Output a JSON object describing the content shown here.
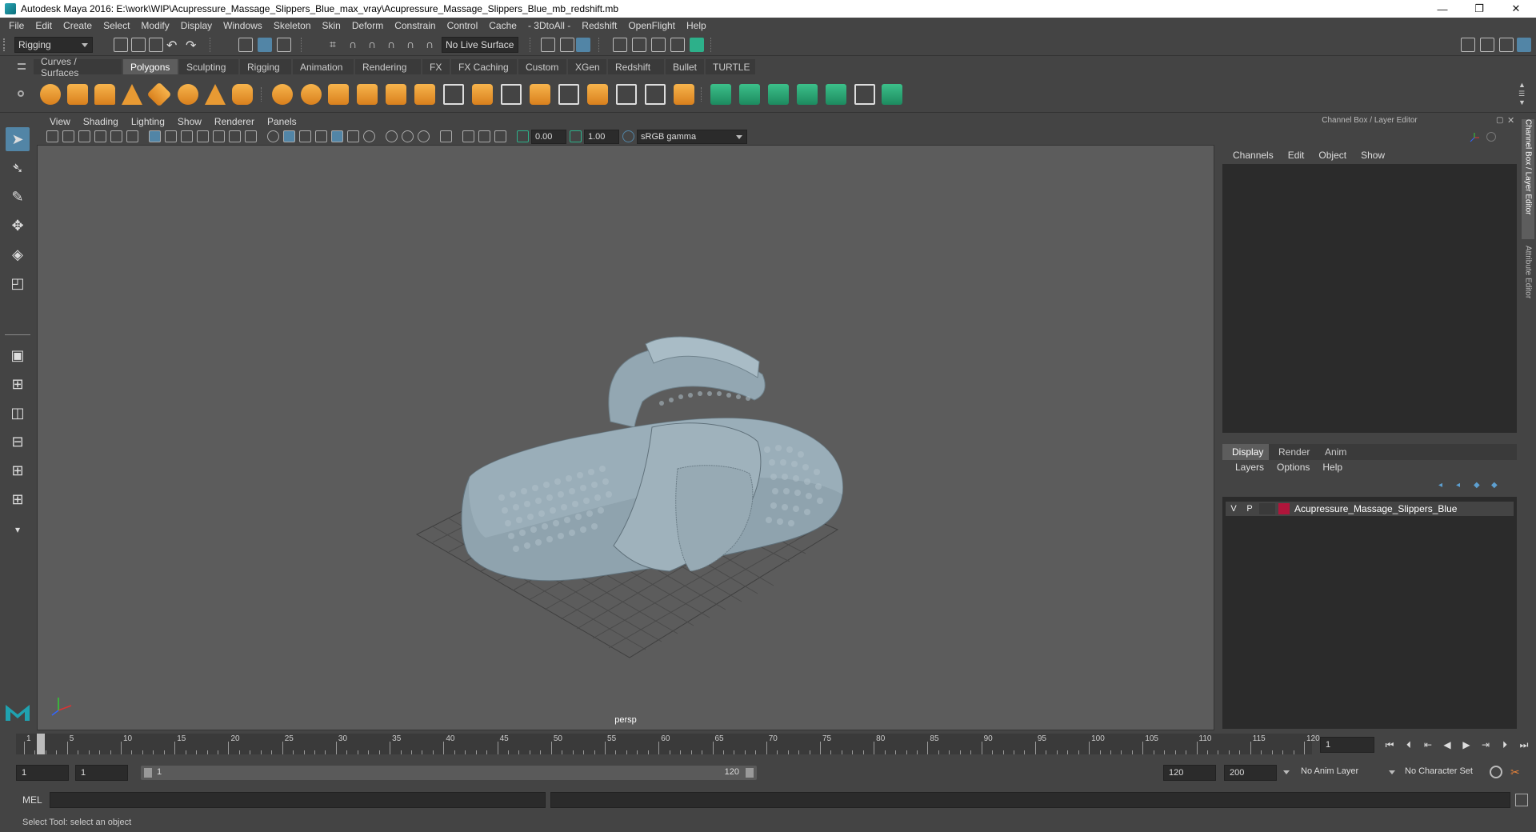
{
  "window": {
    "title": "Autodesk Maya 2016: E:\\work\\WIP\\Acupressure_Massage_Slippers_Blue_max_vray\\Acupressure_Massage_Slippers_Blue_mb_redshift.mb",
    "minimize": "—",
    "maximize": "❐",
    "close": "✕"
  },
  "menubar": [
    "File",
    "Edit",
    "Create",
    "Select",
    "Modify",
    "Display",
    "Windows",
    "Skeleton",
    "Skin",
    "Deform",
    "Constrain",
    "Control",
    "Cache",
    "- 3DtoAll -",
    "Redshift",
    "OpenFlight",
    "Help"
  ],
  "statusline": {
    "mode": "Rigging",
    "live_surface": "No Live Surface"
  },
  "shelf_tabs": [
    {
      "label": "Curves / Surfaces",
      "active": false
    },
    {
      "label": "Polygons",
      "active": true
    },
    {
      "label": "Sculpting",
      "active": false
    },
    {
      "label": "Rigging",
      "active": false
    },
    {
      "label": "Animation",
      "active": false
    },
    {
      "label": "Rendering",
      "active": false
    },
    {
      "label": "FX",
      "active": false
    },
    {
      "label": "FX Caching",
      "active": false
    },
    {
      "label": "Custom",
      "active": false
    },
    {
      "label": "XGen",
      "active": false
    },
    {
      "label": "Redshift",
      "active": false
    },
    {
      "label": "Bullet",
      "active": false
    },
    {
      "label": "TURTLE",
      "active": false
    }
  ],
  "viewport": {
    "menu": [
      "View",
      "Shading",
      "Lighting",
      "Show",
      "Renderer",
      "Panels"
    ],
    "exposure": "0.00",
    "gamma": "1.00",
    "color_space": "sRGB gamma",
    "camera": "persp"
  },
  "right_panel": {
    "header": "Channel Box / Layer Editor",
    "tabs": [
      "Channels",
      "Edit",
      "Object",
      "Show"
    ],
    "layer_tabs": [
      {
        "label": "Display",
        "active": true
      },
      {
        "label": "Render",
        "active": false
      },
      {
        "label": "Anim",
        "active": false
      }
    ],
    "layer_menu": [
      "Layers",
      "Options",
      "Help"
    ],
    "layer": {
      "v": "V",
      "p": "P",
      "name": "Acupressure_Massage_Slippers_Blue",
      "color": "#b0153b"
    },
    "side_tabs": [
      "Channel Box / Layer Editor",
      "Attribute Editor"
    ]
  },
  "timeslider": {
    "labels": [
      "1",
      "5",
      "10",
      "15",
      "20",
      "25",
      "30",
      "35",
      "40",
      "45",
      "50",
      "55",
      "60",
      "65",
      "70",
      "75",
      "80",
      "85",
      "90",
      "95",
      "100",
      "105",
      "110",
      "115",
      "120"
    ],
    "current_frame": "1"
  },
  "range": {
    "start": "1",
    "playback_start": "1",
    "slider_start": "1",
    "slider_end": "120",
    "playback_end": "120",
    "end": "200",
    "anim_layer": "No Anim Layer",
    "character_set": "No Character Set"
  },
  "command": {
    "label": "MEL"
  },
  "help_line": "Select Tool: select an object",
  "colors": {
    "accent": "#5285a6",
    "viewport_bg": "#5c5c5c",
    "model": "#8fa3ae"
  }
}
